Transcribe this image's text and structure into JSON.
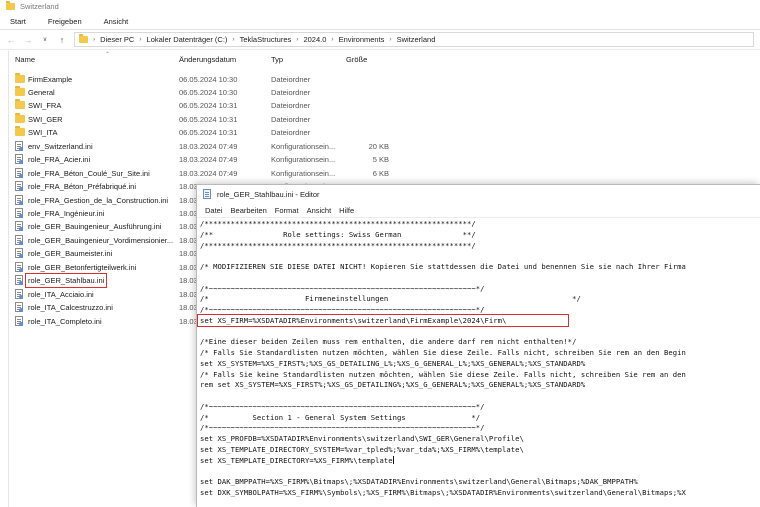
{
  "explorer": {
    "title": "Switzerland",
    "ribbon_tabs": [
      "Start",
      "Freigeben",
      "Ansicht"
    ],
    "breadcrumbs": [
      "Dieser PC",
      "Lokaler Datenträger (C:)",
      "TeklaStructures",
      "2024.0",
      "Environments",
      "Switzerland"
    ],
    "columns": {
      "name": "Name",
      "date": "Änderungsdatum",
      "type": "Typ",
      "size": "Größe"
    },
    "files": [
      {
        "name": "FirmExample",
        "date": "06.05.2024 10:30",
        "type": "Dateiordner",
        "size": "",
        "kind": "folder"
      },
      {
        "name": "General",
        "date": "06.05.2024 10:30",
        "type": "Dateiordner",
        "size": "",
        "kind": "folder"
      },
      {
        "name": "SWI_FRA",
        "date": "06.05.2024 10:31",
        "type": "Dateiordner",
        "size": "",
        "kind": "folder"
      },
      {
        "name": "SWI_GER",
        "date": "06.05.2024 10:31",
        "type": "Dateiordner",
        "size": "",
        "kind": "folder"
      },
      {
        "name": "SWI_ITA",
        "date": "06.05.2024 10:31",
        "type": "Dateiordner",
        "size": "",
        "kind": "folder"
      },
      {
        "name": "env_Switzerland.ini",
        "date": "18.03.2024 07:49",
        "type": "Konfigurationsein...",
        "size": "20 KB",
        "kind": "ini"
      },
      {
        "name": "role_FRA_Acier.ini",
        "date": "18.03.2024 07:49",
        "type": "Konfigurationsein...",
        "size": "5 KB",
        "kind": "ini"
      },
      {
        "name": "role_FRA_Béton_Coulé_Sur_Site.ini",
        "date": "18.03.2024 07:49",
        "type": "Konfigurationsein...",
        "size": "6 KB",
        "kind": "ini"
      },
      {
        "name": "role_FRA_Béton_Préfabriqué.ini",
        "date": "18.03.2024 07:49",
        "type": "Konfigurationsein...",
        "size": "6 KB",
        "kind": "ini"
      },
      {
        "name": "role_FRA_Gestion_de_la_Construction.ini",
        "date": "18.03",
        "type": "",
        "size": "",
        "kind": "ini"
      },
      {
        "name": "role_FRA_Ingénieur.ini",
        "date": "18.03",
        "type": "",
        "size": "",
        "kind": "ini"
      },
      {
        "name": "role_GER_Bauingenieur_Ausführung.ini",
        "date": "18.03",
        "type": "",
        "size": "",
        "kind": "ini"
      },
      {
        "name": "role_GER_Bauingenieur_Vordimensionier...",
        "date": "18.03",
        "type": "",
        "size": "",
        "kind": "ini"
      },
      {
        "name": "role_GER_Baumeister.ini",
        "date": "18.03",
        "type": "",
        "size": "",
        "kind": "ini"
      },
      {
        "name": "role_GER_Betonfertigteilwerk.ini",
        "date": "18.03",
        "type": "",
        "size": "",
        "kind": "ini"
      },
      {
        "name": "role_GER_Stahlbau.ini",
        "date": "18.03",
        "type": "",
        "size": "",
        "kind": "ini",
        "highlighted": true
      },
      {
        "name": "role_ITA_Acciaio.ini",
        "date": "18.03",
        "type": "",
        "size": "",
        "kind": "ini"
      },
      {
        "name": "role_ITA_Calcestruzzo.ini",
        "date": "18.03",
        "type": "",
        "size": "",
        "kind": "ini"
      },
      {
        "name": "role_ITA_Completo.ini",
        "date": "18.03",
        "type": "",
        "size": "",
        "kind": "ini"
      }
    ]
  },
  "notepad": {
    "title": "role_GER_Stahlbau.ini - Editor",
    "menu": [
      "Datei",
      "Bearbeiten",
      "Format",
      "Ansicht",
      "Hilfe"
    ],
    "lines": [
      "/*************************************************************/",
      "/**                Role settings: Swiss German              **/",
      "/*************************************************************/",
      "",
      "/* MODIFIZIEREN SIE DIESE DATEI NICHT! Kopieren Sie stattdessen die Datei und benennen Sie sie nach Ihrer Firma",
      "",
      "/*~~~~~~~~~~~~~~~~~~~~~~~~~~~~~~~~~~~~~~~~~~~~~~~~~~~~~~~~~~~~~*/",
      "/*                      Firmeneinstellungen                                          */",
      "/*~~~~~~~~~~~~~~~~~~~~~~~~~~~~~~~~~~~~~~~~~~~~~~~~~~~~~~~~~~~~~*/",
      "set XS_FIRM=%XSDATADIR%Environments\\switzerland\\FirmExample\\2024\\Firm\\",
      "",
      "/*Eine dieser beiden Zeilen muss rem enthalten, die andere darf rem nicht enthalten!*/",
      "/* Falls Sie Standardlisten nutzen möchten, wählen Sie diese Zeile. Falls nicht, schreiben Sie rem an den Begin",
      "set XS_SYSTEM=%XS_FIRST%;%XS_GS_DETAILING_L%;%XS_G_GENERAL_L%;%XS_GENERAL%;%XS_STANDARD%",
      "/* Falls Sie keine Standardlisten nutzen möchten, wählen Sie diese Zeile. Falls nicht, schreiben Sie rem an den",
      "rem set XS_SYSTEM=%XS_FIRST%;%XS_GS_DETAILING%;%XS_G_GENERAL%;%XS_GENERAL%;%XS_STANDARD%",
      "",
      "/*~~~~~~~~~~~~~~~~~~~~~~~~~~~~~~~~~~~~~~~~~~~~~~~~~~~~~~~~~~~~~*/",
      "/*          Section 1 - General System Settings               */",
      "/*~~~~~~~~~~~~~~~~~~~~~~~~~~~~~~~~~~~~~~~~~~~~~~~~~~~~~~~~~~~~~*/",
      "set XS_PROFDB=%XSDATADIR%Environments\\switzerland\\SWI_GER\\General\\Profile\\",
      "set XS_TEMPLATE_DIRECTORY_SYSTEM=%var_tpled%;%var_tda%;%XS_FIRM%\\template\\",
      "set XS_TEMPLATE_DIRECTORY=%XS_FIRM%\\template",
      "",
      "set DAK_BMPPATH=%XS_FIRM%\\Bitmaps\\;%XSDATADIR%Environments\\switzerland\\General\\Bitmaps;%DAK_BMPPATH%",
      "set DXK_SYMBOLPATH=%XS_FIRM%\\Symbols\\;%XS_FIRM%\\Bitmaps\\;%XSDATADIR%Environments\\switzerland\\General\\Bitmaps;%X"
    ]
  }
}
